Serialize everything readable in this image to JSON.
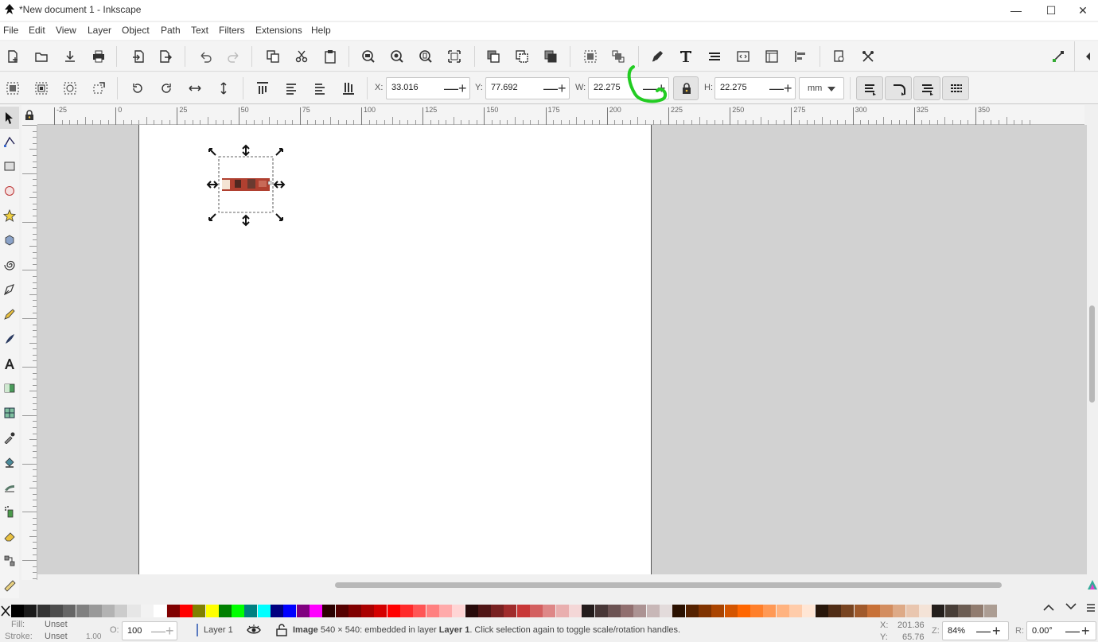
{
  "window": {
    "title": "*New document 1 - Inkscape",
    "minimize_glyph": "—",
    "maximize_glyph": "☐",
    "close_glyph": "✕"
  },
  "menu": {
    "items": [
      "File",
      "Edit",
      "View",
      "Layer",
      "Object",
      "Path",
      "Text",
      "Filters",
      "Extensions",
      "Help"
    ]
  },
  "commands": {
    "icons": [
      "new-document-icon",
      "open-icon",
      "save-icon",
      "print-icon",
      "import-icon",
      "export-icon",
      "undo-icon",
      "redo-icon",
      "copy-icon",
      "cut-icon",
      "paste-icon",
      "zoom-selection-icon",
      "zoom-drawing-icon",
      "zoom-page-icon",
      "zoom-page-width-icon",
      "duplicate-icon",
      "clone-icon",
      "unlink-clone-icon",
      "group-icon",
      "ungroup-icon",
      "fill-stroke-icon",
      "text-font-icon",
      "layers-icon",
      "xml-editor-icon",
      "document-properties-icon",
      "align-distribute-icon",
      "preferences-icon",
      "snap-settings-icon",
      "snap-toggle-icon",
      "collapse-sidebar-icon"
    ]
  },
  "controls": {
    "x_label": "X:",
    "x_value": "33.016",
    "y_label": "Y:",
    "y_value": "77.692",
    "w_label": "W:",
    "w_value": "22.275",
    "h_label": "H:",
    "h_value": "22.275",
    "unit": "mm",
    "minus_glyph": "—",
    "plus_glyph": "+",
    "lock_icon": "lock-icon"
  },
  "rulers": {
    "horizontal_ticks": [
      "-25",
      "0",
      "25",
      "50",
      "75",
      "100",
      "125",
      "150",
      "175",
      "200",
      "225",
      "250",
      "275",
      "300",
      "325",
      "350"
    ]
  },
  "palette": {
    "colors": [
      "#000000",
      "#1a1a1a",
      "#333333",
      "#4d4d4d",
      "#666666",
      "#808080",
      "#999999",
      "#b3b3b3",
      "#cccccc",
      "#e6e6e6",
      "#f2f2f2",
      "#ffffff",
      "#800000",
      "#ff0000",
      "#808000",
      "#ffff00",
      "#008000",
      "#00ff00",
      "#008080",
      "#00ffff",
      "#000080",
      "#0000ff",
      "#800080",
      "#ff00ff",
      "#2b0000",
      "#550000",
      "#800000",
      "#aa0000",
      "#d40000",
      "#ff0000",
      "#ff2a2a",
      "#ff5555",
      "#ff8080",
      "#ffaaaa",
      "#ffd5d5",
      "#280b0b",
      "#501616",
      "#782121",
      "#a02c2c",
      "#c83737",
      "#d35f5f",
      "#de8787",
      "#e9afaf",
      "#f4d7d7",
      "#241c1c",
      "#483737",
      "#6c5353",
      "#916f6f",
      "#ac9393",
      "#c8b7b7",
      "#e3dbdb",
      "#2b1100",
      "#552200",
      "#803300",
      "#aa4400",
      "#d45500",
      "#ff6600",
      "#ff7f2a",
      "#ff9955",
      "#ffb380",
      "#ffccaa",
      "#ffe6d5",
      "#28170b",
      "#502d16",
      "#784421",
      "#a05a2c",
      "#c87137",
      "#d38d5f",
      "#deaa87",
      "#e9c6af",
      "#f4e3d7",
      "#241f1c",
      "#483e37",
      "#6c5d53",
      "#917c6f",
      "#ac9d93",
      "#c8beb7"
    ]
  },
  "status": {
    "fill_label": "Fill:",
    "fill_value": "Unset",
    "stroke_label": "Stroke:",
    "stroke_value": "Unset",
    "stroke_width": "1.00",
    "opacity_label": "O:",
    "opacity_value": "100",
    "layer_name": "Layer 1",
    "message_prefix": "Image",
    "message_dims": " 540 × 540: embedded in layer ",
    "message_layer": "Layer 1",
    "message_suffix": ". Click selection again to toggle scale/rotation handles.",
    "cursor_x_label": "X:",
    "cursor_x": "201.36",
    "cursor_y_label": "Y:",
    "cursor_y": "65.76",
    "zoom_label": "Z:",
    "zoom_value": "84%",
    "rotation_label": "R:",
    "rotation_value": "0.00°"
  },
  "annotation": {
    "color": "#22cc22"
  }
}
